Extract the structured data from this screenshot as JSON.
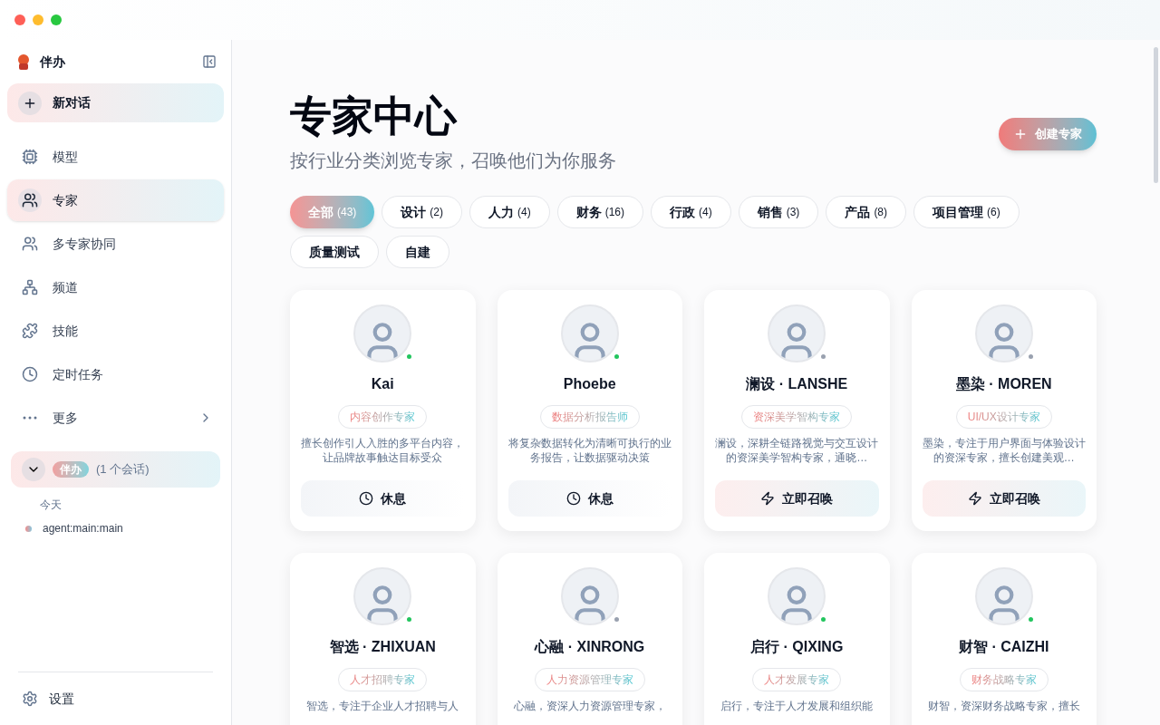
{
  "app": {
    "name": "伴办"
  },
  "sidebar": {
    "new_chat": "新对话",
    "items": [
      {
        "label": "模型",
        "selected": false
      },
      {
        "label": "专家",
        "selected": true
      },
      {
        "label": "多专家协同",
        "selected": false
      },
      {
        "label": "频道",
        "selected": false
      },
      {
        "label": "技能",
        "selected": false
      },
      {
        "label": "定时任务",
        "selected": false
      },
      {
        "label": "更多",
        "selected": false
      }
    ],
    "group": {
      "badge": "伴办",
      "count": "(1 个会话)",
      "expanded": true,
      "day": "今天",
      "sessions": [
        "agent:main:main"
      ]
    },
    "settings": "设置"
  },
  "header": {
    "title": "专家中心",
    "subtitle": "按行业分类浏览专家，召唤他们为你服务",
    "create_button": "创建专家"
  },
  "filters": [
    {
      "label": "全部",
      "count": "(43)",
      "selected": true
    },
    {
      "label": "设计",
      "count": "(2)",
      "selected": false
    },
    {
      "label": "人力",
      "count": "(4)",
      "selected": false
    },
    {
      "label": "财务",
      "count": "(16)",
      "selected": false
    },
    {
      "label": "行政",
      "count": "(4)",
      "selected": false
    },
    {
      "label": "销售",
      "count": "(3)",
      "selected": false
    },
    {
      "label": "产品",
      "count": "(8)",
      "selected": false
    },
    {
      "label": "项目管理",
      "count": "(6)",
      "selected": false
    },
    {
      "label": "质量测试",
      "selected": false
    },
    {
      "label": "自建",
      "selected": false
    }
  ],
  "experts": [
    {
      "name": "Kai",
      "online": true,
      "tag": "内容创作专家",
      "description": "擅长创作引人入胜的多平台内容，让品牌故事触达目标受众",
      "action": {
        "kind": "rest",
        "label": "休息"
      }
    },
    {
      "name": "Phoebe",
      "online": true,
      "tag": "数据分析报告师",
      "description": "将复杂数据转化为清晰可执行的业务报告，让数据驱动决策",
      "action": {
        "kind": "rest",
        "label": "休息"
      }
    },
    {
      "name": "澜设 · LANSHE",
      "online": false,
      "tag": "资深美学智构专家",
      "description": "澜设，深耕全链路视觉与交互设计的资深美学智构专家，通晓…",
      "action": {
        "kind": "summon",
        "label": "立即召唤"
      }
    },
    {
      "name": "墨染 · MOREN",
      "online": false,
      "tag": "UI/UX设计专家",
      "description": "墨染，专注于用户界面与体验设计的资深专家，擅长创建美观…",
      "action": {
        "kind": "summon",
        "label": "立即召唤"
      }
    },
    {
      "name": "智选 · ZHIXUAN",
      "online": true,
      "tag": "人才招聘专家",
      "description": "智选，专注于企业人才招聘与人"
    },
    {
      "name": "心融 · XINRONG",
      "online": false,
      "tag": "人力资源管理专家",
      "description": "心融，资深人力资源管理专家，"
    },
    {
      "name": "启行 · QIXING",
      "online": true,
      "tag": "人才发展专家",
      "description": "启行，专注于人才发展和组织能"
    },
    {
      "name": "财智 · CAIZHI",
      "online": true,
      "tag": "财务战略专家",
      "description": "财智，资深财务战略专家，擅长"
    }
  ]
}
